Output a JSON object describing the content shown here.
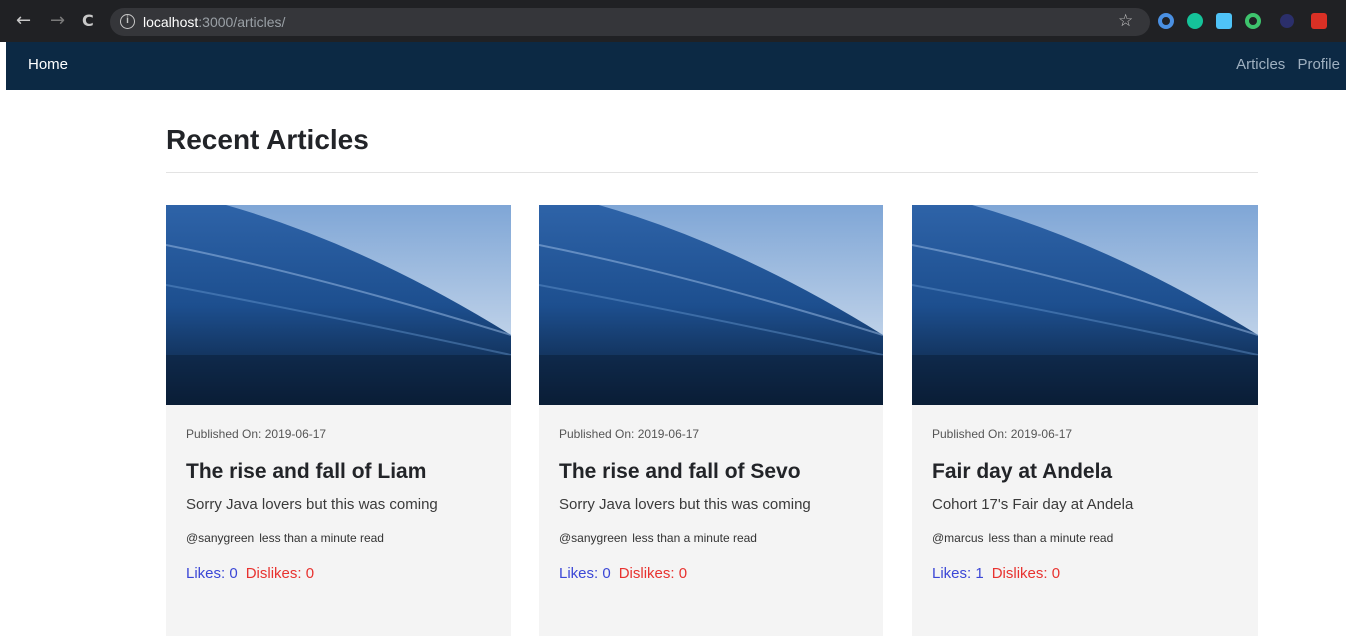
{
  "browser": {
    "url_host": "localhost",
    "url_path": ":3000/articles/",
    "back_icon": "←",
    "forward_icon": "→",
    "reload_icon": "C",
    "info_icon": "i",
    "star_icon": "☆"
  },
  "navbar": {
    "home": "Home",
    "links": [
      "Articles",
      "Profile"
    ]
  },
  "page": {
    "title": "Recent Articles"
  },
  "articles": [
    {
      "published": "Published On: 2019-06-17",
      "title": "The rise and fall of Liam",
      "description": "Sorry Java lovers but this was coming",
      "author": "@sanygreen",
      "read_time": "less than a minute read",
      "likes": "Likes: 0",
      "dislikes": "Dislikes: 0"
    },
    {
      "published": "Published On: 2019-06-17",
      "title": "The rise and fall of Sevo",
      "description": "Sorry Java lovers but this was coming",
      "author": "@sanygreen",
      "read_time": "less than a minute read",
      "likes": "Likes: 0",
      "dislikes": "Dislikes: 0"
    },
    {
      "published": "Published On: 2019-06-17",
      "title": "Fair day at Andela",
      "description": "Cohort 17's Fair day at Andela",
      "author": "@marcus",
      "read_time": "less than a minute read",
      "likes": "Likes: 1",
      "dislikes": "Dislikes: 0"
    }
  ],
  "colors": {
    "navbar_bg": "#0c2944",
    "likes": "#3b47d6",
    "dislikes": "#e8322f",
    "card_bg": "#f4f4f4"
  }
}
